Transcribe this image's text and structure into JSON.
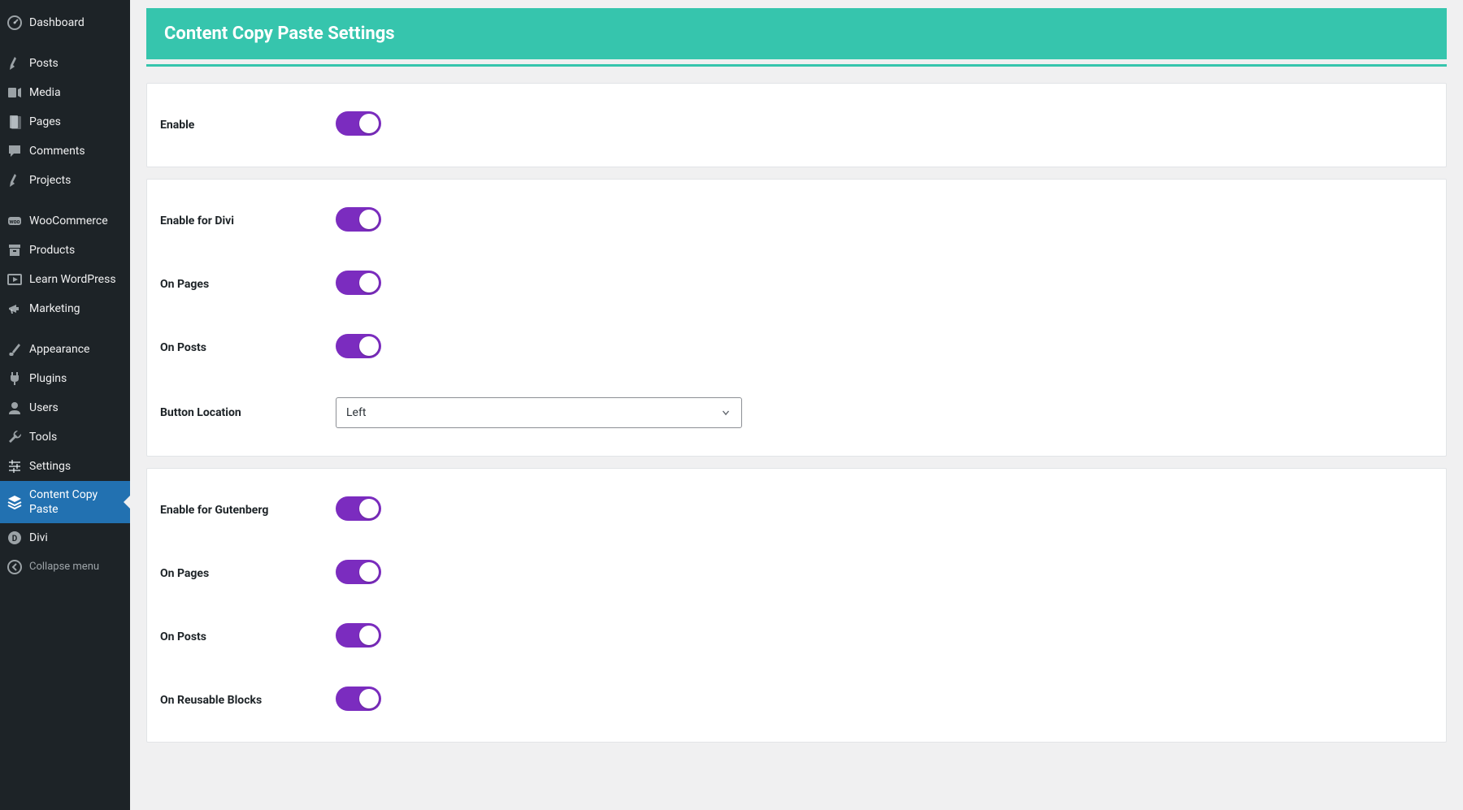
{
  "sidebar": {
    "items": [
      {
        "label": "Dashboard",
        "icon": "dashboard"
      },
      {
        "sep": true
      },
      {
        "label": "Posts",
        "icon": "pin"
      },
      {
        "label": "Media",
        "icon": "media"
      },
      {
        "label": "Pages",
        "icon": "page"
      },
      {
        "label": "Comments",
        "icon": "comment"
      },
      {
        "label": "Projects",
        "icon": "pin"
      },
      {
        "sep": true
      },
      {
        "label": "WooCommerce",
        "icon": "woo"
      },
      {
        "label": "Products",
        "icon": "archive"
      },
      {
        "label": "Learn WordPress",
        "icon": "video"
      },
      {
        "label": "Marketing",
        "icon": "megaphone"
      },
      {
        "sep": true
      },
      {
        "label": "Appearance",
        "icon": "brush"
      },
      {
        "label": "Plugins",
        "icon": "plug"
      },
      {
        "label": "Users",
        "icon": "user"
      },
      {
        "label": "Tools",
        "icon": "wrench"
      },
      {
        "label": "Settings",
        "icon": "sliders"
      },
      {
        "label": "Content Copy Paste",
        "icon": "stack",
        "active": true
      },
      {
        "label": "Divi",
        "icon": "divi"
      },
      {
        "label": "Collapse menu",
        "icon": "collapse",
        "collapse": true
      }
    ]
  },
  "header": {
    "title": "Content Copy Paste Settings"
  },
  "panels": [
    {
      "rows": [
        {
          "label": "Enable",
          "type": "toggle",
          "value": true
        }
      ]
    },
    {
      "rows": [
        {
          "label": "Enable for Divi",
          "type": "toggle",
          "value": true
        },
        {
          "label": "On Pages",
          "type": "toggle",
          "value": true
        },
        {
          "label": "On Posts",
          "type": "toggle",
          "value": true
        },
        {
          "label": "Button Location",
          "type": "select",
          "value": "Left"
        }
      ]
    },
    {
      "rows": [
        {
          "label": "Enable for Gutenberg",
          "type": "toggle",
          "value": true
        },
        {
          "label": "On Pages",
          "type": "toggle",
          "value": true
        },
        {
          "label": "On Posts",
          "type": "toggle",
          "value": true
        },
        {
          "label": "On Reusable Blocks",
          "type": "toggle",
          "value": true
        }
      ]
    }
  ]
}
